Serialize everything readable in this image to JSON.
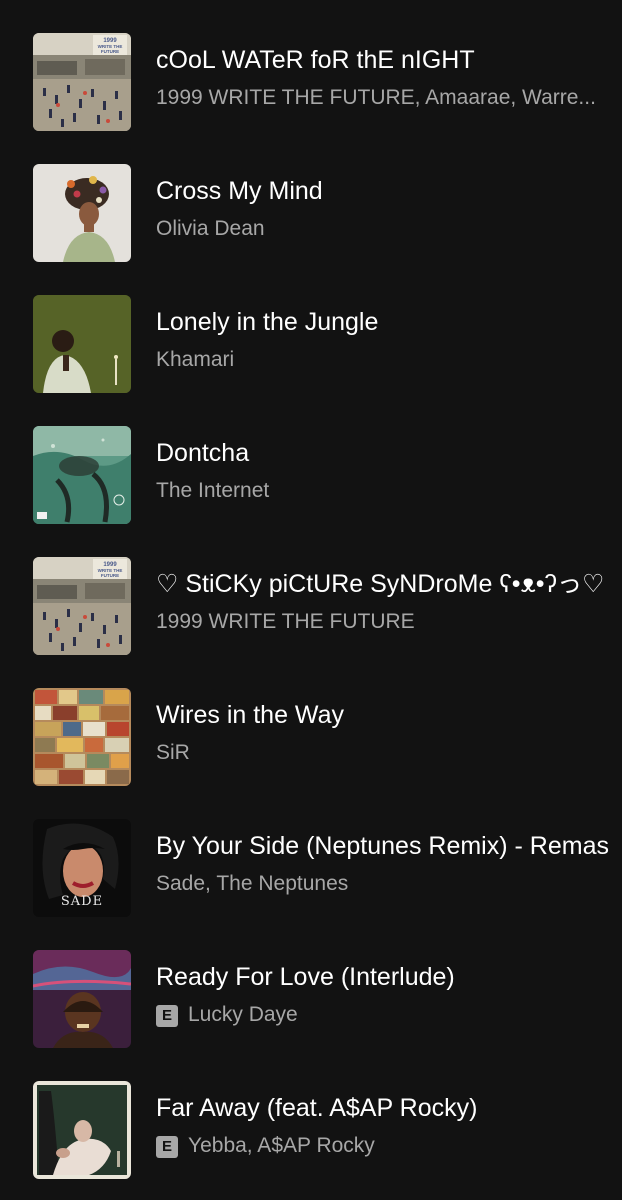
{
  "tracks": [
    {
      "title": "cOoL WATeR foR thE nIGHT",
      "artists": "1999 WRITE THE FUTURE, Amaarae, Warre...",
      "explicit": false,
      "cover": "1999-write-the-future-cover"
    },
    {
      "title": "Cross My Mind",
      "artists": "Olivia Dean",
      "explicit": false,
      "cover": "olivia-dean-cover"
    },
    {
      "title": "Lonely in the Jungle",
      "artists": "Khamari",
      "explicit": false,
      "cover": "khamari-cover"
    },
    {
      "title": "Dontcha",
      "artists": "The Internet",
      "explicit": false,
      "cover": "the-internet-cover"
    },
    {
      "title": "♡ StiCKy piCtURe SyNDroMe ʕ•ᴥ•ʔっ♡",
      "artists": "1999 WRITE THE FUTURE",
      "explicit": false,
      "cover": "1999-write-the-future-cover"
    },
    {
      "title": "Wires in the Way",
      "artists": "SiR",
      "explicit": false,
      "cover": "sir-cover"
    },
    {
      "title": "By Your Side (Neptunes Remix) - Remas",
      "artists": "Sade, The Neptunes",
      "explicit": false,
      "cover": "sade-cover"
    },
    {
      "title": "Ready For Love (Interlude)",
      "artists": "Lucky Daye",
      "explicit": true,
      "cover": "lucky-daye-cover"
    },
    {
      "title": "Far Away (feat. A$AP Rocky)",
      "artists": "Yebba, A$AP Rocky",
      "explicit": true,
      "cover": "yebba-cover"
    }
  ],
  "explicit_badge": "E",
  "cover_art": {
    "cover1999": {
      "title": "1999 WRITE THE FUTURE"
    },
    "sade": {
      "text": "SADE"
    }
  },
  "colors": {
    "background": "#121212",
    "title": "#ffffff",
    "subtitle": "#a7a7a7"
  }
}
